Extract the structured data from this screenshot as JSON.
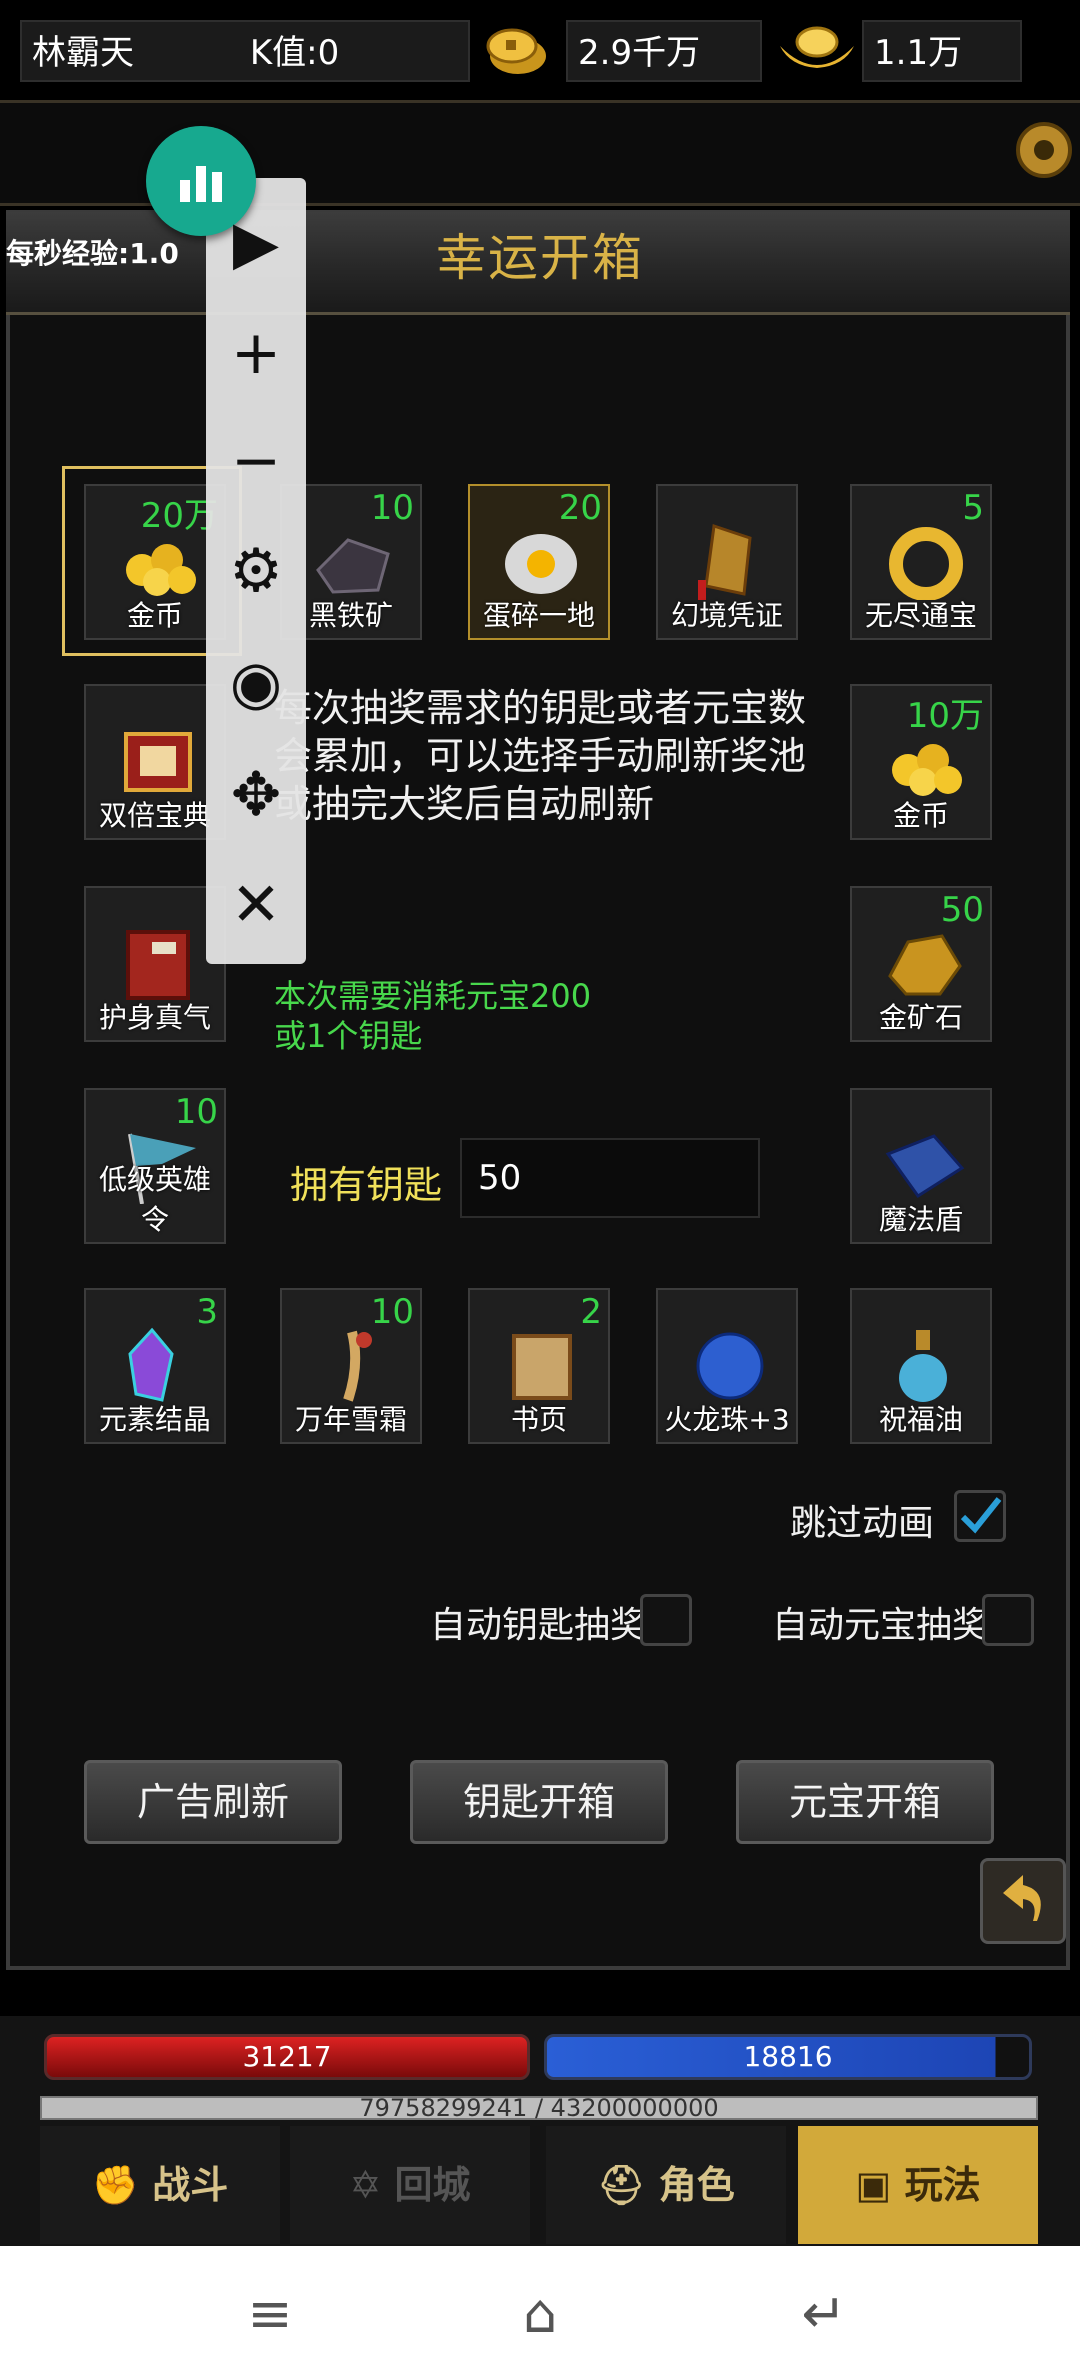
{
  "topbar": {
    "player_name": "林霸天",
    "pk_label": "K值:0",
    "gold": "2.9千万",
    "yuanbao": "1.1万",
    "exp_per_sec": "每秒经验:1.0"
  },
  "title": "幸运开箱",
  "items": [
    {
      "name": "金币",
      "qty": "20万"
    },
    {
      "name": "黑铁矿",
      "qty": "10"
    },
    {
      "name": "蛋碎一地",
      "qty": "20"
    },
    {
      "name": "幻境凭证",
      "qty": ""
    },
    {
      "name": "无尽通宝",
      "qty": "5"
    },
    {
      "name": "双倍宝典",
      "qty": ""
    },
    {
      "name": "金币",
      "qty": "10万"
    },
    {
      "name": "护身真气",
      "qty": ""
    },
    {
      "name": "金矿石",
      "qty": "50"
    },
    {
      "name": "低级英雄令",
      "qty": "10"
    },
    {
      "name": "魔法盾",
      "qty": ""
    },
    {
      "name": "元素结晶",
      "qty": "3"
    },
    {
      "name": "万年雪霜",
      "qty": "10"
    },
    {
      "name": "书页",
      "qty": "2"
    },
    {
      "name": "火龙珠+3",
      "qty": ""
    },
    {
      "name": "祝福油",
      "qty": ""
    }
  ],
  "description": "每次抽奖需求的钥匙或者元宝数会累加，可以选择手动刷新奖池或抽完大奖后自动刷新",
  "cost_line1": "本次需要消耗元宝200",
  "cost_line2": "或1个钥匙",
  "keys": {
    "label": "拥有钥匙",
    "value": "50"
  },
  "options": {
    "skip_animation": "跳过动画",
    "auto_key": "自动钥匙抽奖",
    "auto_yuanbao": "自动元宝抽奖"
  },
  "buttons": {
    "ad_refresh": "广告刷新",
    "key_open": "钥匙开箱",
    "yuanbao_open": "元宝开箱"
  },
  "stats": {
    "hp": "31217",
    "mp": "18816",
    "exp": "79758299241 / 43200000000"
  },
  "tabs": [
    "战斗",
    "回城",
    "角色",
    "玩法"
  ],
  "colors": {
    "accent_gold": "#d9b347",
    "qty_green": "#37d449",
    "hp_red": "#d22222",
    "mp_blue": "#2a5fd6"
  }
}
